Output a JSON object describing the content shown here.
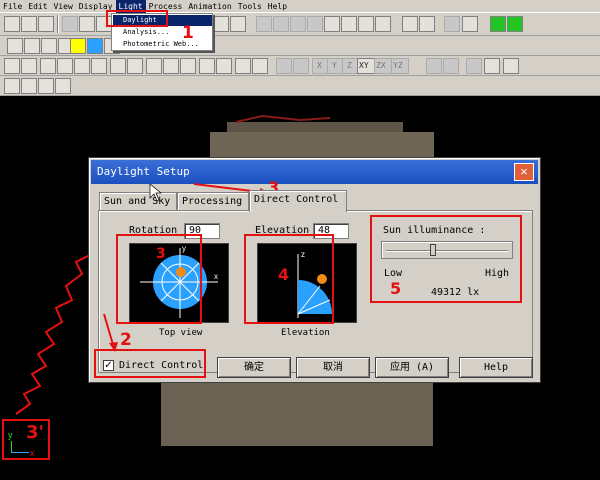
{
  "menubar": {
    "items": [
      "File",
      "Edit",
      "View",
      "Display",
      "Light",
      "Process",
      "Animation",
      "Tools",
      "Help"
    ],
    "active_index": 4
  },
  "toolbar": {
    "axis_buttons": [
      "X",
      "Y",
      "Z",
      "XY",
      "ZX",
      "YZ"
    ]
  },
  "light_menu": {
    "items": [
      "Daylight",
      "Analysis...",
      "Photometric Web..."
    ],
    "selected_index": 0
  },
  "dialog": {
    "title": "Daylight Setup",
    "tabs": [
      "Sun and Sky",
      "Processing",
      "Direct Control"
    ],
    "active_tab_index": 2,
    "rotation": {
      "label": "Rotation",
      "value": "90"
    },
    "elevation": {
      "label": "Elevation",
      "value": "48"
    },
    "top_view": {
      "caption": "Top view",
      "axis_x": "x",
      "axis_y": "y"
    },
    "elevation_view": {
      "caption": "Elevation",
      "axis_z": "z"
    },
    "illuminance": {
      "label": "Sun illuminance :",
      "low": "Low",
      "high": "High",
      "value": "49312",
      "unit": "lx",
      "slider_position": 0.38
    },
    "direct_control_checkbox": {
      "label": "Direct Control",
      "checked": true
    },
    "buttons": {
      "ok": "确定",
      "cancel": "取消",
      "apply": "应用 (A)",
      "help": "Help"
    }
  },
  "annotations": {
    "callouts": [
      "1",
      "2",
      "3",
      "3",
      "4",
      "5",
      "3'"
    ],
    "color": "#e51010"
  },
  "viewport": {
    "axis_y": "y",
    "axis_x": "x"
  },
  "colors": {
    "menu_highlight": "#0a246a",
    "titlebar": "#1b4fc0",
    "sun": "#f08a18",
    "dome": "#2aa0ff"
  }
}
